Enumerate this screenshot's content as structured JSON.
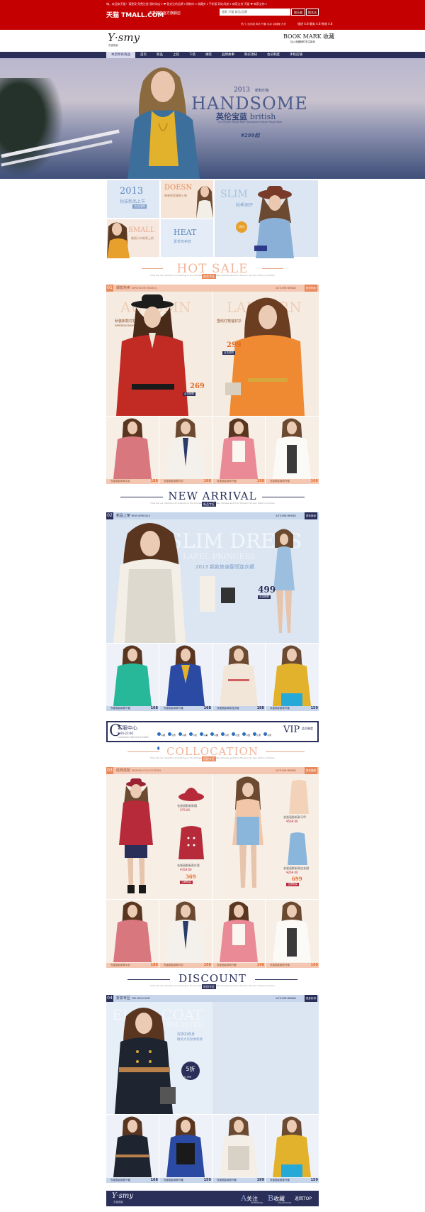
{
  "header": {
    "top_links": "嗨，欢迎来天猫！请登录 免费注册 我的淘宝 ▾ ♥ 我关注的品牌 ▾ 购物车 ▾ 收藏夹 ▾ 手机版 网站导航 ▾ 商家支持 天猫  ♥ 商家支持 ▾",
    "logo": "天猫 TMALL.COM",
    "shop_name": "衣香丽影官方旗舰店",
    "search_placeholder": "搜索 天猫 商品/品牌",
    "search_tmall_btn": "搜天猫",
    "search_shop_btn": "搜本店",
    "hot_words": "热门: 连衣裙 风衣 外套 毛衫 羽绒服 大衣",
    "shop_info": "描述 4.8 服务 4.8 物流 4.8"
  },
  "brand": {
    "logo": "Y·smy",
    "logo_sub": "衣香丽影",
    "bookmark": "BOOK MARK 收藏",
    "bookmark_sub": "加入收藏随时关注新品",
    "nav": [
      "本店所有商品",
      "首页",
      "新品",
      "上装",
      "下装",
      "裙装",
      "品牌故事",
      "购买须知",
      "会员制度",
      "手机店铺"
    ]
  },
  "hero": {
    "year_tag": "2013",
    "season_tag": "新秋印象",
    "headline": "HANDSOME",
    "headline_cn": "英伦宝蓝",
    "headline_en": "british",
    "small_copy": "Hiu Stylish Royal Blue Handsome British Royal Blue",
    "price": "¥299起"
  },
  "promo": {
    "year": "2013",
    "year_cn": "秋装新品上市",
    "year_btn": "点击抢购",
    "doesn": "DOESN",
    "doesn_cn": "新装秋款服装上新",
    "slim": "SLIM",
    "slim_cn": "秋季测评",
    "coat_cn": "秋季新品",
    "small": "SMALL",
    "small_cn": "美丽小衫新款上新",
    "heat": "HEAT",
    "heat_cn": "夏季热卖款",
    "coupon": "10元"
  },
  "sections": {
    "hot_sale": {
      "title": "HOT SALE",
      "badge": "热卖专区",
      "sub": "Hive the ice collection of drawing on the Chinese hand-spun fiber Chinese and from those in its own history archives"
    },
    "new_arrival": {
      "title": "NEW ARRIVAL",
      "badge": "新品专区",
      "sub": "Hive the ice collection of drawing on the Chinese hand-spun fiber Chinese and from those in its own history archives"
    },
    "collocation": {
      "title": "COLLOCATION",
      "badge": "搭配专区",
      "sub": "Hive the ice collection of drawing on the Chinese hand-spun fiber Chinese and from those in its own history archives"
    },
    "discount": {
      "title": "DISCOUNT",
      "badge": "折扣专区",
      "sub": "Hive the ice collection of drawing on the Chinese hand-spun fiber Chinese and from those in its own history archives"
    }
  },
  "bars": {
    "s1": {
      "num": "01",
      "cn": "爆款热卖",
      "en": "EXPLOSION MODELS",
      "right": "AUTUMN BRAND",
      "more": "更多热卖"
    },
    "s2": {
      "num": "02",
      "cn": "新品上架",
      "en": "NEW ARRIVALS",
      "right": "AUTUMN BRAND",
      "more": "更多新品"
    },
    "s3": {
      "num": "03",
      "cn": "经典搭配",
      "en": "FASHION COLLOCATION",
      "right": "AUTUMN BRAND",
      "more": "更多搭配"
    },
    "s4": {
      "num": "04",
      "cn": "折扣专区",
      "en": "THE DISCOUNT",
      "right": "AUTUMN BRAND",
      "more": "更多折扣"
    }
  },
  "hot": {
    "left_big": "AUTUMN",
    "left_cn": "秋装新款衬衫",
    "left_en": "IMPRESSIONSHIP",
    "left_price": "269",
    "left_btn": "点击抢购",
    "right_big": "LANTERN",
    "right_cn": "雪纺灯笼袖衬衫",
    "right_price": "299",
    "right_btn": "点击抢购",
    "cards": [
      {
        "label": "衣香丽影新款毛衫",
        "price": "188"
      },
      {
        "label": "衣香丽影新款衬衫",
        "price": "168"
      },
      {
        "label": "衣香丽影新款外套",
        "price": "198"
      },
      {
        "label": "衣香丽影新款外套",
        "price": "168"
      }
    ]
  },
  "arrival": {
    "big": "SLIM DRESS",
    "big2": "LAPEL PRINCESS",
    "year_cn": "2013 新款修身翻领连衣裙",
    "price": "499",
    "btn": "点击抢购",
    "cards": [
      {
        "label": "衣香丽影新款外套",
        "price": "168"
      },
      {
        "label": "衣香丽影新款外套",
        "price": "168"
      },
      {
        "label": "衣香丽影新款连衣裙",
        "price": "188"
      },
      {
        "label": "衣香丽影新款外套",
        "price": "159"
      }
    ]
  },
  "service": {
    "title": "客服中心",
    "title_en": "Customer Service Center",
    "hours": "9:00-23:00",
    "agents": [
      "小丽",
      "小影",
      "小香",
      "小衣",
      "小美",
      "小雅",
      "小可",
      "小爱",
      "小佳",
      "小芳",
      "小月",
      "小云",
      "小雪",
      "小蓝"
    ],
    "vip": "VIP",
    "vip_cn": "会员制度"
  },
  "collocation": {
    "item1": "衣香丽影新款帽",
    "item1_price": "¥79.00",
    "item2": "衣香丽影新款外套",
    "item2_price": "¥359.00",
    "combo_price": "369",
    "combo_btn": "立即购买",
    "item3": "衣香丽影新款马甲",
    "item3_price": "¥569.00",
    "item4": "衣香丽影新款连衣裙",
    "item4_price": "¥269.00",
    "combo2_price": "699",
    "combo2_btn": "立即购买",
    "cards": [
      {
        "label": "衣香丽影新款毛衫",
        "price": "188"
      },
      {
        "label": "衣香丽影新款衬衫",
        "price": "168"
      },
      {
        "label": "衣香丽影新款外套",
        "price": "198"
      },
      {
        "label": "衣香丽影新款外套",
        "price": "168"
      }
    ]
  },
  "discount": {
    "big": "ELITE COAT",
    "big2": "DOUBLE BREASTED",
    "cn1": "双排扣修身",
    "cn2": "精英大衣秋季新款",
    "badge": "5折",
    "badge_price": "¥ 399",
    "cards": [
      {
        "label": "衣香丽影新款外套",
        "price": "168"
      },
      {
        "label": "衣香丽影新款外套",
        "price": "159"
      },
      {
        "label": "衣香丽影新款外套",
        "price": "199"
      },
      {
        "label": "衣香丽影新款外套",
        "price": "159"
      }
    ]
  },
  "footer": {
    "logo": "Y·smy",
    "logo_sub": "衣香丽影",
    "follow": "关注",
    "follow_en": "ATTENTION",
    "collect": "收藏",
    "collect_en": "COLLECTION",
    "top": "返回TOP"
  },
  "colors": {
    "tmall_red": "#c40000",
    "navy": "#2a2f5a",
    "salmon": "#f2b59a",
    "light_blue": "#dbe6f2",
    "price_orange": "#e46b2a"
  }
}
